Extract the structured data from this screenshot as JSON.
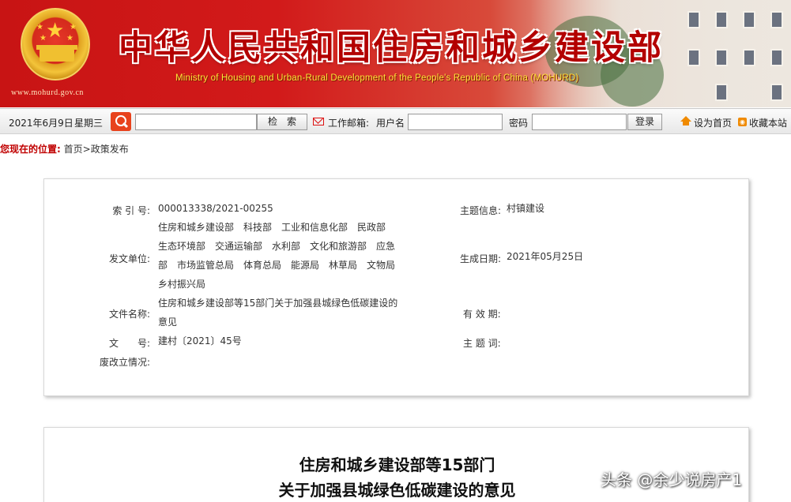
{
  "banner": {
    "title": "中华人民共和国住房和城乡建设部",
    "subtitle": "Ministry of Housing and Urban-Rural Development of the People's Republic of China (MOHURD)",
    "site_url": "www.mohurd.gov.cn",
    "emblem_icon": "national-emblem-icon"
  },
  "toolbar": {
    "date": "2021年6月9日",
    "weekday": "星期三",
    "search_icon": "search-icon",
    "search_value": "",
    "search_button": "检　索",
    "mail_icon": "mail-icon",
    "mail_label": "工作邮箱:",
    "username_label": "用户名",
    "username_value": "",
    "password_label": "密码",
    "password_value": "",
    "login_button": "登录",
    "set_home_icon": "home-icon",
    "set_home": "设为首页",
    "bookmark_icon": "rss-icon",
    "bookmark": "收藏本站"
  },
  "breadcrumb": {
    "label": "您现在的位置:",
    "home": "首页",
    "separator": ">",
    "current": "政策发布"
  },
  "info": {
    "index_label": "索 引 号:",
    "index_value": "000013338/2021-00255",
    "topic_label": "主题信息:",
    "topic_value": "村镇建设",
    "issuer_label": "发文单位:",
    "issuer_value": "住房和城乡建设部　科技部　工业和信息化部　民政部　生态环境部　交通运输部　水利部　文化和旅游部　应急部　市场监管总局　体育总局　能源局　林草局　文物局　乡村振兴局",
    "date_label": "生成日期:",
    "date_value": "2021年05月25日",
    "filename_label": "文件名称:",
    "filename_value": "住房和城乡建设部等15部门关于加强县城绿色低碳建设的意见",
    "validity_label": "有 效 期:",
    "validity_value": "",
    "docno_label": "文　　号:",
    "docno_value": "建村〔2021〕45号",
    "keywords_label": "主 题 词:",
    "keywords_value": "",
    "status_label": "废改立情况:",
    "status_value": ""
  },
  "document": {
    "title_line1": "住房和城乡建设部等15部门",
    "title_line2": "关于加强县城绿色低碳建设的意见"
  },
  "watermark": "头条 @余少说房产1",
  "colors": {
    "banner_red": "#c81414",
    "title_red": "#b30000",
    "subtitle_yellow": "#ffe23a",
    "breadcrumb_red": "#c00000",
    "search_orange": "#e8421c",
    "accent_orange": "#f08a00"
  }
}
